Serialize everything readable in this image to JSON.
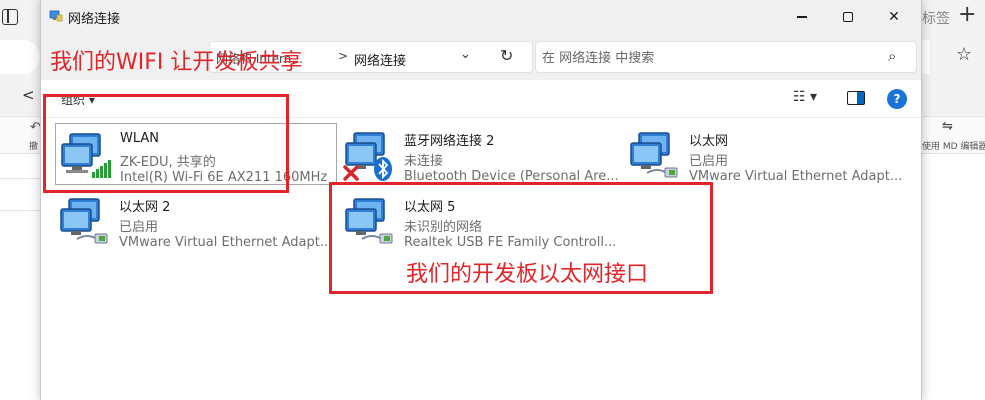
{
  "window": {
    "title": "网络连接",
    "minimize": "—",
    "close": "✕"
  },
  "address": {
    "crumb_parent": "网络和 Intern...",
    "separator": ">",
    "crumb_current": "网络连接",
    "dropdown": "⌄",
    "refresh": "↻"
  },
  "search": {
    "placeholder": "在 网络连接 中搜索",
    "icon": "⌕"
  },
  "command_bar": {
    "organize": "组织 ▾",
    "view": "☷ ▾",
    "help": "?"
  },
  "connections": [
    {
      "name": "WLAN",
      "status": "ZK-EDU, 共享的",
      "device": "Intel(R) Wi-Fi 6E AX211 160MHz",
      "icon": "wifi-adapter-icon"
    },
    {
      "name": "蓝牙网络连接 2",
      "status": "未连接",
      "device": "Bluetooth Device (Personal Are...",
      "icon": "bluetooth-adapter-icon"
    },
    {
      "name": "以太网",
      "status": "已启用",
      "device": "VMware Virtual Ethernet Adapt...",
      "icon": "ethernet-adapter-icon"
    },
    {
      "name": "以太网 2",
      "status": "已启用",
      "device": "VMware Virtual Ethernet Adapt...",
      "icon": "ethernet-adapter-icon"
    },
    {
      "name": "以太网 5",
      "status": "未识别的网络",
      "device": "Realtek USB FE Family Controll...",
      "icon": "ethernet-adapter-icon"
    }
  ],
  "annotations": {
    "wifi_note": "我们的WIFI 让开发板共享",
    "board_note": "我们的开发板以太网接口",
    "color": "#e0262b"
  },
  "background_app": {
    "tab_fragment": "标签",
    "new_tab": "+",
    "undo_label": "撤",
    "md_label": "使用 MD 编辑器",
    "back": "<"
  }
}
